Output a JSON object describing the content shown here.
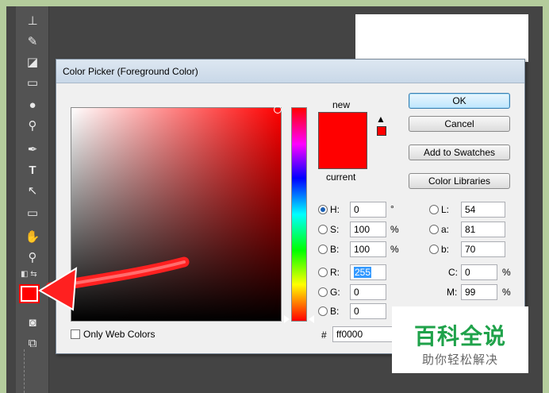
{
  "dialog": {
    "title": "Color Picker (Foreground Color)",
    "new_label": "new",
    "current_label": "current",
    "buttons": {
      "ok": "OK",
      "cancel": "Cancel",
      "add_to_swatches": "Add to Swatches",
      "color_libraries": "Color Libraries"
    },
    "hsb": {
      "h": {
        "label": "H:",
        "value": "0",
        "unit": "°"
      },
      "s": {
        "label": "S:",
        "value": "100",
        "unit": "%"
      },
      "b": {
        "label": "B:",
        "value": "100",
        "unit": "%"
      }
    },
    "rgb": {
      "r": {
        "label": "R:",
        "value": "255"
      },
      "g": {
        "label": "G:",
        "value": "0"
      },
      "b": {
        "label": "B:",
        "value": "0"
      }
    },
    "lab": {
      "l": {
        "label": "L:",
        "value": "54"
      },
      "a": {
        "label": "a:",
        "value": "81"
      },
      "b": {
        "label": "b:",
        "value": "70"
      }
    },
    "cmyk": {
      "c": {
        "label": "C:",
        "value": "0",
        "unit": "%"
      },
      "m": {
        "label": "M:",
        "value": "99",
        "unit": "%"
      }
    },
    "only_web_colors": "Only Web Colors",
    "hex_prefix": "#",
    "hex_value": "ff0000",
    "new_color": "#ff0000",
    "current_color": "#ff0000"
  },
  "toolbar": {
    "foreground_color": "#ff0000",
    "icons": [
      "stamp-icon",
      "history-brush-icon",
      "eraser-icon",
      "gradient-icon",
      "blur-icon",
      "dodge-icon",
      "pen-icon",
      "type-icon",
      "path-select-icon",
      "rectangle-icon",
      "hand-icon",
      "zoom-icon",
      "quick-mask-icon",
      "screen-mode-icon"
    ]
  },
  "watermark": {
    "main": "百科全说",
    "sub": "助你轻松解决"
  }
}
